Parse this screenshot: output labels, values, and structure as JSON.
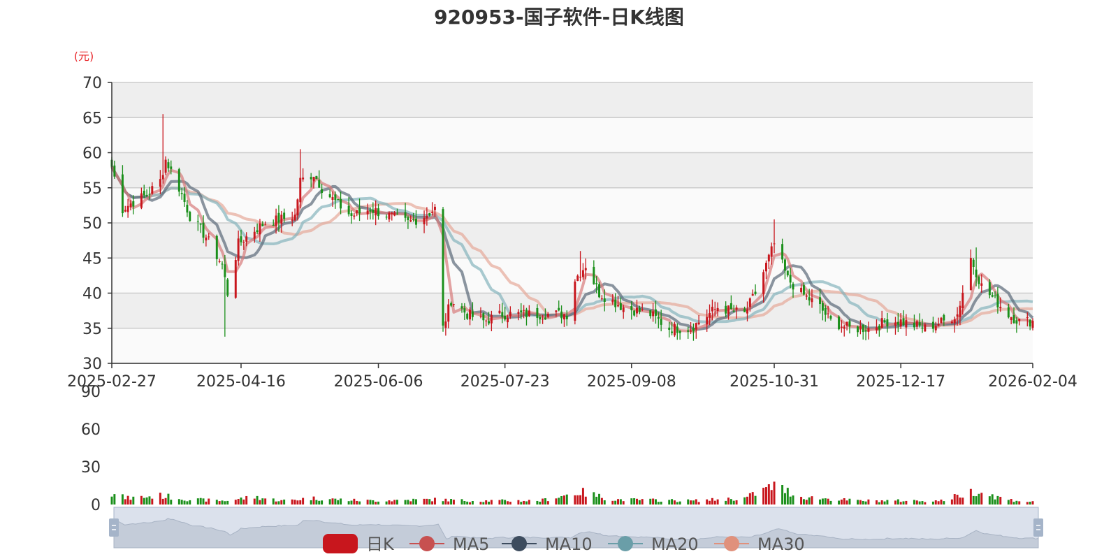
{
  "chart_data": {
    "type": "candlestick",
    "title": "920953-国子软件-日K线图",
    "y_unit": "(元)",
    "price_axis": {
      "min": 30,
      "max": 70,
      "ticks": [
        30,
        35,
        40,
        45,
        50,
        55,
        60,
        65,
        70
      ]
    },
    "volume_axis": {
      "min": 0,
      "max": 90,
      "ticks": [
        0,
        30,
        60,
        90
      ]
    },
    "x_axis": {
      "start": "2025-02-27",
      "end": "2026-02-04",
      "tick_labels": [
        "2025-02-27",
        "2025-04-16",
        "2025-06-06",
        "2025-07-23",
        "2025-09-08",
        "2025-10-31",
        "2025-12-17",
        "2026-02-04"
      ]
    },
    "legend": [
      "日K",
      "MA5",
      "MA10",
      "MA20",
      "MA30"
    ],
    "colors": {
      "up": "#c8161d",
      "down": "#1a8f1a",
      "ma5": "#d77b7b",
      "ma10": "#5a6878",
      "ma20": "#84b4bc",
      "ma30": "#e5a898",
      "band_dark": "#eeeeee",
      "band_light": "#fafafa",
      "grid": "#cccccc",
      "slider": "#dbe1ec",
      "slider_border": "#a5b4c9"
    },
    "close_anchors": [
      [
        "2025-02-27",
        58
      ],
      [
        "2025-03-03",
        52
      ],
      [
        "2025-03-07",
        53
      ],
      [
        "2025-03-12",
        54
      ],
      [
        "2025-03-17",
        56
      ],
      [
        "2025-03-19",
        59
      ],
      [
        "2025-03-24",
        55
      ],
      [
        "2025-03-28",
        51
      ],
      [
        "2025-04-03",
        48
      ],
      [
        "2025-04-09",
        44
      ],
      [
        "2025-04-11",
        40
      ],
      [
        "2025-04-15",
        47
      ],
      [
        "2025-04-21",
        49
      ],
      [
        "2025-04-25",
        50
      ],
      [
        "2025-05-06",
        51
      ],
      [
        "2025-05-08",
        56
      ],
      [
        "2025-05-13",
        57
      ],
      [
        "2025-05-16",
        55
      ],
      [
        "2025-05-21",
        53
      ],
      [
        "2025-05-27",
        51
      ],
      [
        "2025-06-03",
        52
      ],
      [
        "2025-06-10",
        51
      ],
      [
        "2025-06-17",
        50
      ],
      [
        "2025-06-23",
        51
      ],
      [
        "2025-06-27",
        52
      ],
      [
        "2025-06-30",
        35
      ],
      [
        "2025-07-03",
        39
      ],
      [
        "2025-07-09",
        37
      ],
      [
        "2025-07-15",
        36
      ],
      [
        "2025-07-22",
        37
      ],
      [
        "2025-08-05",
        37
      ],
      [
        "2025-08-15",
        37
      ],
      [
        "2025-08-18",
        42
      ],
      [
        "2025-08-22",
        44
      ],
      [
        "2025-08-27",
        40
      ],
      [
        "2025-09-05",
        38
      ],
      [
        "2025-09-15",
        37
      ],
      [
        "2025-09-22",
        35
      ],
      [
        "2025-09-30",
        35
      ],
      [
        "2025-10-10",
        38
      ],
      [
        "2025-10-20",
        37
      ],
      [
        "2025-10-24",
        40
      ],
      [
        "2025-10-31",
        47
      ],
      [
        "2025-11-05",
        42
      ],
      [
        "2025-11-10",
        40
      ],
      [
        "2025-11-17",
        38
      ],
      [
        "2025-11-21",
        36
      ],
      [
        "2025-11-28",
        35
      ],
      [
        "2025-12-05",
        35
      ],
      [
        "2025-12-12",
        36
      ],
      [
        "2025-12-17",
        36
      ],
      [
        "2025-12-26",
        35
      ],
      [
        "2026-01-02",
        36
      ],
      [
        "2026-01-07",
        37
      ],
      [
        "2026-01-12",
        45
      ],
      [
        "2026-01-16",
        41
      ],
      [
        "2026-01-21",
        39
      ],
      [
        "2026-01-26",
        37
      ],
      [
        "2026-01-30",
        36
      ],
      [
        "2026-02-04",
        36
      ]
    ],
    "volume_anchors": [
      [
        "2025-02-27",
        8
      ],
      [
        "2025-03-05",
        5
      ],
      [
        "2025-03-17",
        7
      ],
      [
        "2025-03-28",
        4
      ],
      [
        "2025-04-10",
        3
      ],
      [
        "2025-04-21",
        6
      ],
      [
        "2025-05-01",
        3
      ],
      [
        "2025-05-12",
        5
      ],
      [
        "2025-06-01",
        3
      ],
      [
        "2025-06-27",
        4
      ],
      [
        "2025-07-10",
        3
      ],
      [
        "2025-08-05",
        3
      ],
      [
        "2025-08-20",
        10
      ],
      [
        "2025-09-01",
        4
      ],
      [
        "2025-10-01",
        3
      ],
      [
        "2025-10-20",
        5
      ],
      [
        "2025-10-31",
        15
      ],
      [
        "2025-11-10",
        6
      ],
      [
        "2025-12-01",
        3
      ],
      [
        "2026-01-01",
        3
      ],
      [
        "2026-01-14",
        11
      ],
      [
        "2026-01-25",
        4
      ],
      [
        "2026-02-04",
        2
      ]
    ],
    "event_highs": [
      [
        "2025-03-18",
        65.5
      ],
      [
        "2025-05-08",
        60.5
      ],
      [
        "2025-08-20",
        46
      ],
      [
        "2025-10-31",
        50.5
      ],
      [
        "2026-01-14",
        46.5
      ]
    ],
    "event_lows": [
      [
        "2025-04-10",
        33.8
      ],
      [
        "2025-06-30",
        34.5
      ],
      [
        "2025-10-02",
        33.5
      ]
    ]
  }
}
